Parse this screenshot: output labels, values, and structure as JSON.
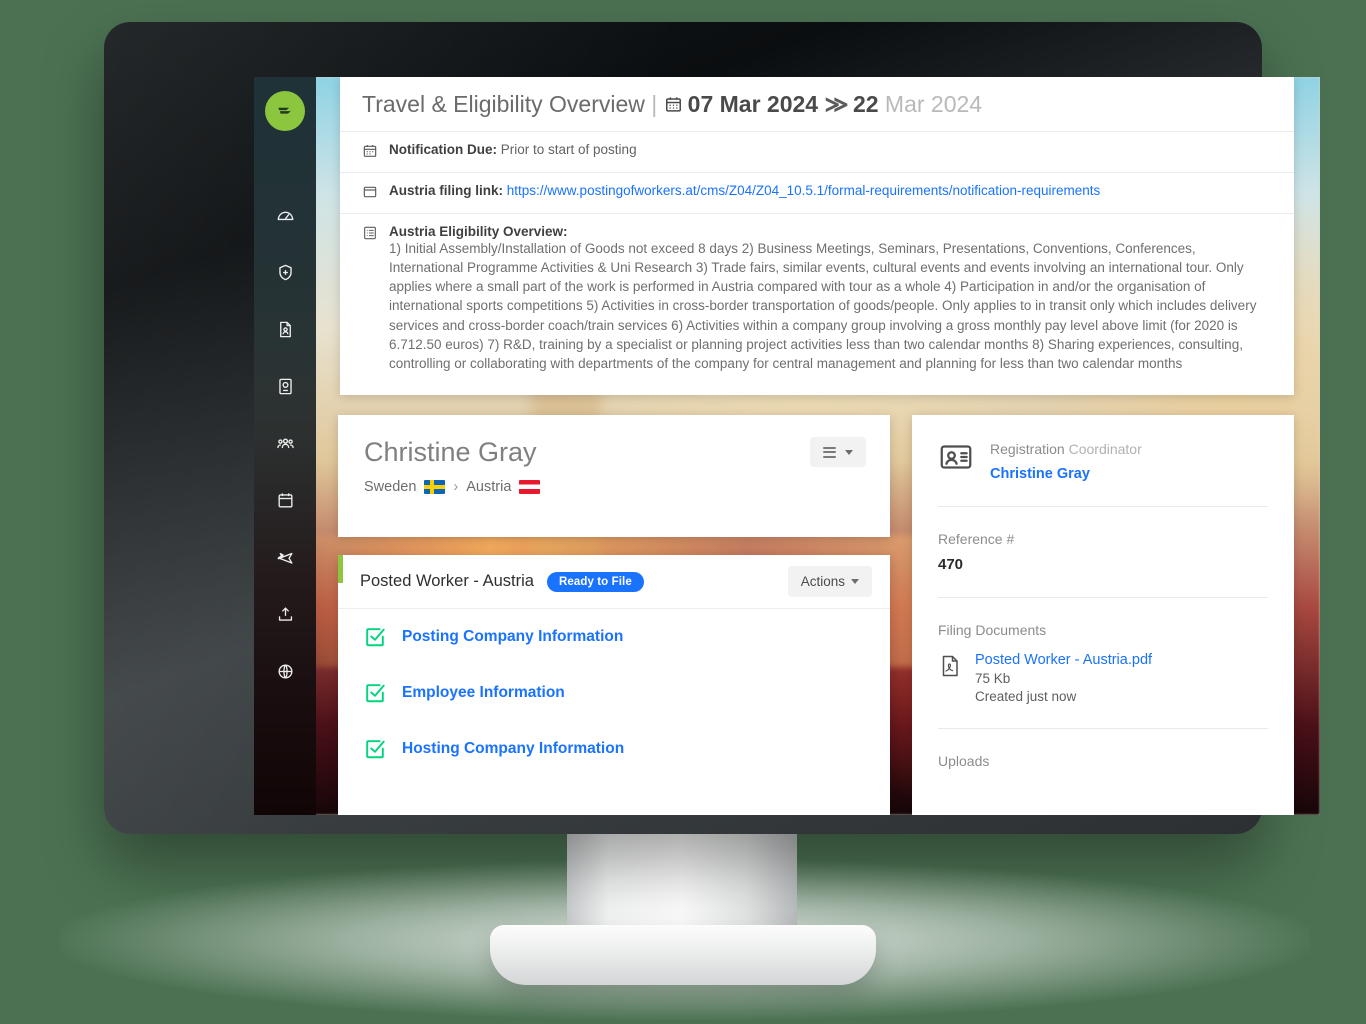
{
  "sidebar": {
    "logo": "emburse-logo-icon",
    "items": [
      {
        "icon": "gauge-dashboard-icon",
        "name": "sidebar-item-dashboard"
      },
      {
        "icon": "shield-compliance-icon",
        "name": "sidebar-item-compliance"
      },
      {
        "icon": "document-person-icon",
        "name": "sidebar-item-assignments"
      },
      {
        "icon": "passport-icon",
        "name": "sidebar-item-passport"
      },
      {
        "icon": "people-group-icon",
        "name": "sidebar-item-people"
      },
      {
        "icon": "calendar-icon",
        "name": "sidebar-item-calendar"
      },
      {
        "icon": "airplane-icon",
        "name": "sidebar-item-travel"
      },
      {
        "icon": "upload-icon",
        "name": "sidebar-item-uploads"
      },
      {
        "icon": "globe-icon",
        "name": "sidebar-item-global"
      }
    ]
  },
  "overview": {
    "title_main": "Travel & Eligibility Overview",
    "separator": "|",
    "start_date": "07 Mar 2024",
    "arrow": "≫",
    "end_date_bold": "22",
    "end_date_rest": " Mar 2024",
    "notification_label": "Notification Due:",
    "notification_value": "Prior to start of posting",
    "filing_link_label": "Austria filing link:",
    "filing_link_url": "https://www.postingofworkers.at/cms/Z04/Z04_10.5.1/formal-requirements/notification-requirements",
    "eligibility_heading": "Austria Eligibility Overview:",
    "eligibility_body": "1) Initial Assembly/Installation of Goods not exceed 8 days 2) Business Meetings, Seminars, Presentations, Conventions, Conferences, International Programme Activities & Uni Research 3) Trade fairs, similar events, cultural events and events involving an international tour. Only applies where a small part of the work is performed in Austria compared with tour as a whole 4) Participation in and/or the organisation of international sports competitions 5) Activities in cross-border transportation of goods/people. Only applies to in transit only which includes delivery services and cross-border coach/train services 6) Activities within a company group involving a gross monthly pay level above limit (for 2020 is 6.712.50 euros) 7) R&D, training by a specialist or planning project activities less than two calendar months 8) Sharing experiences, consulting, controlling or collaborating with departments of the company for central management and planning for less than two calendar months"
  },
  "person": {
    "name": "Christine Gray",
    "origin_country": "Sweden",
    "origin_flag": "sweden-flag-icon",
    "route_separator": "›",
    "destination_country": "Austria",
    "destination_flag": "austria-flag-icon",
    "menu_button": "list-menu-button"
  },
  "filing": {
    "title": "Posted Worker - Austria",
    "status_badge": "Ready to File",
    "status_color": "#1a73ff",
    "accent_color": "#8cc63f",
    "actions_label": "Actions",
    "sections": [
      {
        "label": "Posting Company Information",
        "checked": true
      },
      {
        "label": "Employee Information",
        "checked": true
      },
      {
        "label": "Hosting Company Information",
        "checked": true
      }
    ]
  },
  "side_panel": {
    "coordinator_role_bold": "Registration",
    "coordinator_role_light": " Coordinator",
    "coordinator_name": "Christine Gray",
    "reference_label": "Reference #",
    "reference_value": "470",
    "filing_documents_label": "Filing Documents",
    "document_name": "Posted Worker - Austria.pdf",
    "document_size": "75 Kb",
    "document_created": "Created just now",
    "uploads_label": "Uploads"
  },
  "theme": {
    "page_background": "#4b7152",
    "link_blue": "#1a73ff",
    "brand_green": "#8cc63f",
    "check_green": "#00d47e"
  }
}
